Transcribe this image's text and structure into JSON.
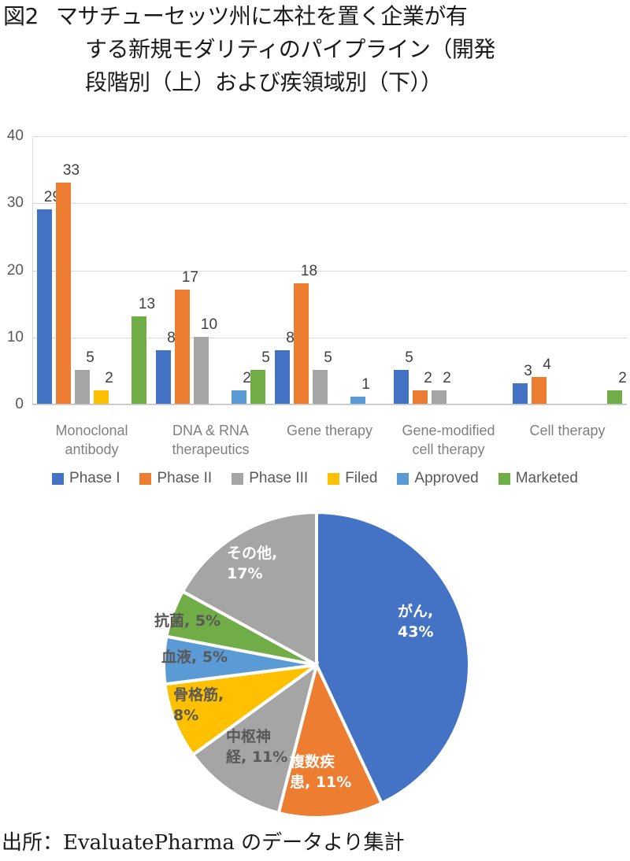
{
  "title": {
    "label": "図2",
    "lines": [
      "マサチューセッツ州に本社を置く企業が有",
      "する新規モダリティのパイプライン（開発",
      "段階別（上）および疾領域別（下））"
    ]
  },
  "source_note": "出所：EvaluatePharma のデータより集計",
  "palette": {
    "phase1": "#4472C4",
    "phase2": "#ED7D31",
    "phase3": "#A5A5A5",
    "filed": "#FFC000",
    "approved": "#5B9BD5",
    "marketed": "#70AD47",
    "gridline": "#D9D9D9",
    "axis_text": "#595959",
    "label_text": "#404040",
    "category_text": "#808080"
  },
  "chart_data": [
    {
      "type": "bar",
      "title": "",
      "xlabel": "",
      "ylabel": "",
      "ylim": [
        0,
        40
      ],
      "yticks": [
        0,
        10,
        20,
        30,
        40
      ],
      "grid": true,
      "legend_position": "bottom",
      "categories": [
        "Monoclonal antibody",
        "DNA & RNA therapeutics",
        "Gene therapy",
        "Gene-modified cell therapy",
        "Cell therapy"
      ],
      "series": [
        {
          "name": "Phase I",
          "color": "#4472C4",
          "values": [
            29,
            8,
            8,
            5,
            3
          ]
        },
        {
          "name": "Phase II",
          "color": "#ED7D31",
          "values": [
            33,
            17,
            18,
            2,
            4
          ]
        },
        {
          "name": "Phase III",
          "color": "#A5A5A5",
          "values": [
            5,
            10,
            5,
            2,
            0
          ]
        },
        {
          "name": "Filed",
          "color": "#FFC000",
          "values": [
            2,
            0,
            0,
            0,
            0
          ]
        },
        {
          "name": "Approved",
          "color": "#5B9BD5",
          "values": [
            0,
            2,
            1,
            0,
            0
          ]
        },
        {
          "name": "Marketed",
          "color": "#70AD47",
          "values": [
            13,
            5,
            0,
            0,
            2
          ]
        }
      ]
    },
    {
      "type": "pie",
      "title": "",
      "labels": [
        "がん",
        "複数疾患",
        "中枢神経",
        "骨格筋",
        "血液",
        "抗菌",
        "その他"
      ],
      "values": [
        43,
        11,
        11,
        8,
        5,
        5,
        17
      ],
      "colors": [
        "#4472C4",
        "#ED7D31",
        "#A5A5A5",
        "#FFC000",
        "#5B9BD5",
        "#70AD47",
        "#A5A5A5"
      ],
      "data_labels": [
        "がん,\n43%",
        "複数疾\n患, 11%",
        "中枢神\n経, 11%",
        "骨格筋,\n8%",
        "血液, 5%",
        "抗菌, 5%",
        "その他,\n17%"
      ]
    }
  ],
  "bar_category_labels": [
    "Monoclonal\nantibody",
    "DNA & RNA\ntherapeutics",
    "Gene therapy",
    "Gene-modified\ncell therapy",
    "Cell therapy"
  ],
  "y_tick_labels": [
    "40",
    "30",
    "20",
    "10",
    "0"
  ]
}
